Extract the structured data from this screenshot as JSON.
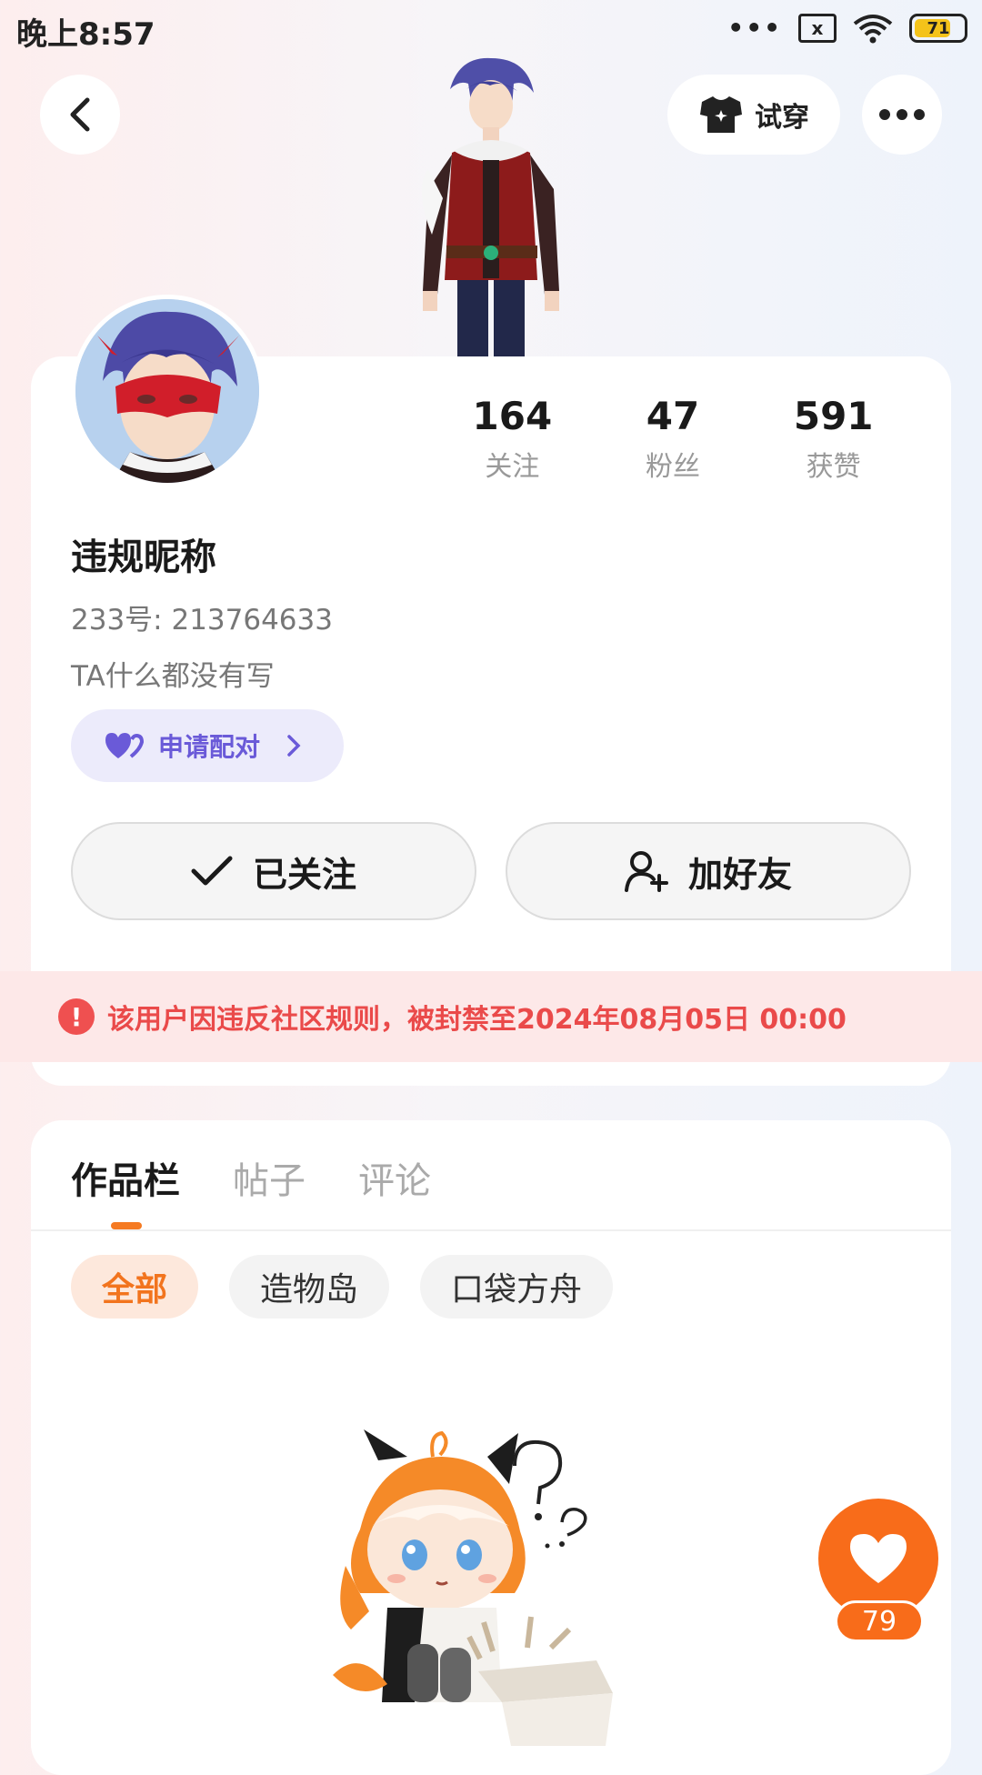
{
  "status_bar": {
    "time": "晚上8:57",
    "battery": "71",
    "sim_icon": "x"
  },
  "header": {
    "try_on_label": "试穿"
  },
  "profile": {
    "stats": [
      {
        "value": "164",
        "label": "关注"
      },
      {
        "value": "47",
        "label": "粉丝"
      },
      {
        "value": "591",
        "label": "获赞"
      }
    ],
    "nickname": "违规昵称",
    "uid": "233号: 213764633",
    "bio": "TA什么都没有写",
    "pair_label": "申请配对",
    "followed_label": "已关注",
    "add_friend_label": "加好友"
  },
  "ban_notice": "该用户因违反社区规则，被封禁至2024年08月05日 00:00",
  "tabs": [
    {
      "label": "作品栏",
      "active": true
    },
    {
      "label": "帖子",
      "active": false
    },
    {
      "label": "评论",
      "active": false
    }
  ],
  "filters": [
    {
      "label": "全部",
      "active": true
    },
    {
      "label": "造物岛",
      "active": false
    },
    {
      "label": "口袋方舟",
      "active": false
    }
  ],
  "like": {
    "count": "79"
  },
  "colors": {
    "accent": "#f57a22",
    "ban_text": "#ea4a4a",
    "pair_purple": "#6a5ad8"
  }
}
